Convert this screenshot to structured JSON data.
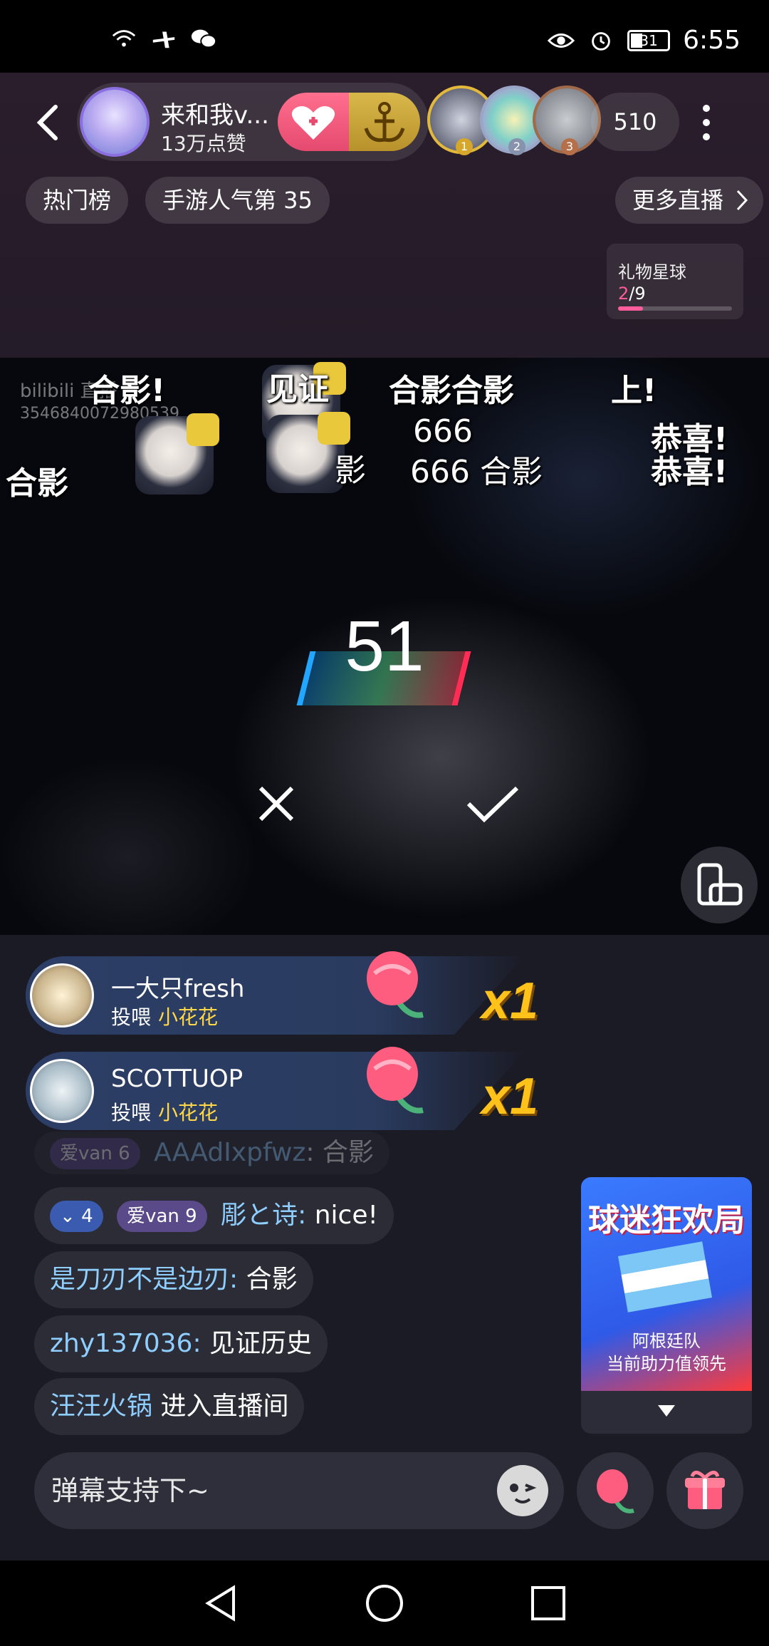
{
  "status_bar": {
    "time": "6:55",
    "battery": "31",
    "icons": [
      "wifi-icon",
      "airplane-icon",
      "wechat-icon",
      "eye-icon",
      "alarm-icon",
      "battery-icon"
    ]
  },
  "header": {
    "host_name": "来和我v...",
    "host_likes": "13万点赞",
    "viewer_count": "510",
    "viewer_ranks": [
      "1",
      "2",
      "3"
    ],
    "tags": [
      "热门榜",
      "手游人气第 35"
    ],
    "more_live": "更多直播",
    "gift_planet": {
      "title": "礼物星球",
      "current": "2",
      "total": "/9",
      "progress": 0.22
    }
  },
  "video": {
    "watermark": "bilibili 直播",
    "watermark_id": "3546840072980539",
    "danmaku": [
      "合影!",
      "见证",
      "合影合影",
      "上!",
      "666",
      "恭喜!",
      "合影",
      "影",
      "666 合影",
      "恭喜!",
      "合影"
    ],
    "countdown": "51"
  },
  "chat": {
    "gifts": [
      {
        "user": "一大只fresh",
        "action": "投喂",
        "gift": "小花花",
        "count": "x1"
      },
      {
        "user": "SCOTTUOP",
        "action": "投喂",
        "gift": "小花花",
        "count": "x1"
      }
    ],
    "faded_message": {
      "badge": "爱van",
      "badge_level": "6",
      "name": "AAAdIxpfwz",
      "text": "合影"
    },
    "messages": [
      {
        "level": "4",
        "fan_badge": "爱van",
        "fan_level": "9",
        "name": "彫と诗:",
        "text": " nice!"
      },
      {
        "name": "是刀刃不是边刃:",
        "text": " 合影"
      },
      {
        "name": "zhy137036:",
        "text": " 见证历史"
      },
      {
        "name": "汪汪火锅",
        "text": " 进入直播间"
      }
    ]
  },
  "promo": {
    "title": "球迷狂欢局",
    "line1": "阿根廷队",
    "line2": "当前助力值领先"
  },
  "input": {
    "placeholder": "弹幕支持下~"
  },
  "colors": {
    "accent_pink": "#ff5c9b",
    "gift_gold": "#ffc21a",
    "username_blue": "#8fcfff"
  }
}
